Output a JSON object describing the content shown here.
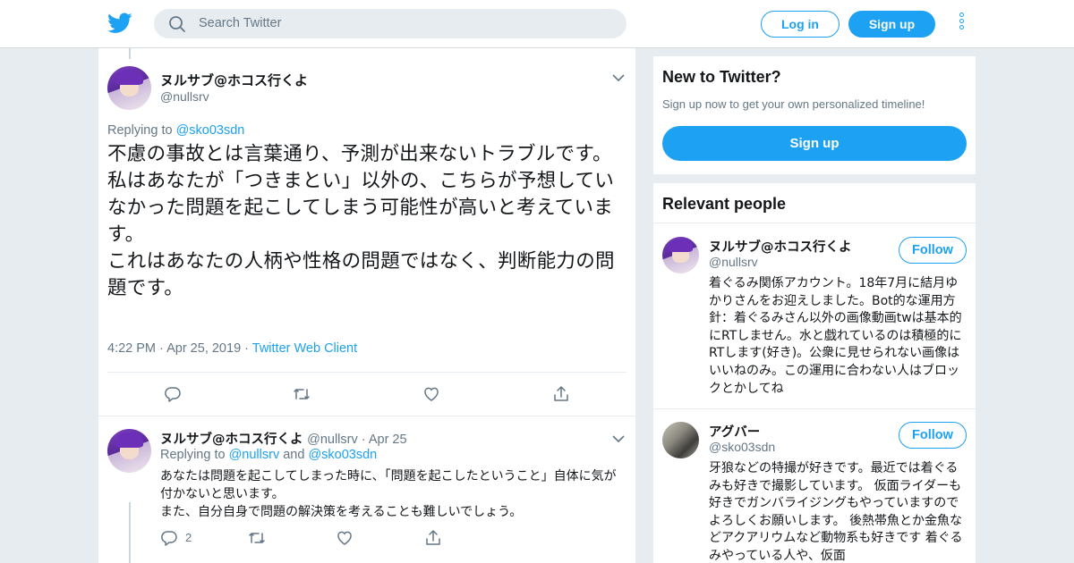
{
  "header": {
    "search_placeholder": "Search Twitter",
    "login_label": "Log in",
    "signup_label": "Sign up"
  },
  "tweet": {
    "author_name": "ヌルサブ@ホコス行くよ",
    "author_handle": "@nullsrv",
    "replying_to_prefix": "Replying to ",
    "replying_to": "@sko03sdn",
    "text": "不慮の事故とは言葉通り、予測が出来ないトラブルです。\n私はあなたが「つきまとい」以外の、こちらが予想していなかった問題を起こしてしまう可能性が高いと考えています。\nこれはあなたの人柄や性格の問題ではなく、判断能力の問題です。",
    "time": "4:22 PM",
    "date": "Apr 25, 2019",
    "source": "Twitter Web Client"
  },
  "reply": {
    "author_name": "ヌルサブ@ホコス行くよ",
    "author_handle": "@nullsrv",
    "date": "Apr 25",
    "replying_to_prefix": "Replying to ",
    "replying_to_1": "@nullsrv",
    "replying_to_and": " and ",
    "replying_to_2": "@sko03sdn",
    "text": "あなたは問題を起こしてしまった時に、「問題を起こしたということ」自体に気が付かないと思います。\nまた、自分自身で問題の解決策を考えることも難しいでしょう。",
    "reply_count": "2"
  },
  "sidebar": {
    "new_title": "New to Twitter?",
    "new_subtitle": "Sign up now to get your own personalized timeline!",
    "new_signup": "Sign up",
    "relevant_title": "Relevant people",
    "people": [
      {
        "name": "ヌルサブ@ホコス行くよ",
        "handle": "@nullsrv",
        "follow": "Follow",
        "bio": "着ぐるみ関係アカウント。18年7月に結月ゆかりさんをお迎えしました。Bot的な運用方針：着ぐるみさん以外の画像動画twは基本的にRTしません。水と戯れているのは積極的にRTします(好き)。公衆に見せられない画像はいいねのみ。この運用に合わない人はブロックとかしてね"
      },
      {
        "name": "アグバー",
        "handle": "@sko03sdn",
        "follow": "Follow",
        "bio": "牙狼などの特撮が好きです。最近では着ぐるみも好きで撮影しています。 仮面ライダーも好きでガンバライジングもやっていますのでよろしくお願いします。 後熱帯魚とか金魚などアクアリウムなど動物系も好きです 着ぐるみやっている人や、仮面"
      }
    ]
  },
  "colors": {
    "accent": "#1da1f2",
    "background": "#e6ecf0",
    "muted_text": "#657786"
  },
  "icons": {
    "logo": "twitter-bird-icon",
    "search": "search-icon",
    "more": "more-vertical-icon",
    "caret": "chevron-down-icon",
    "reply": "reply-icon",
    "retweet": "retweet-icon",
    "like": "heart-icon",
    "share": "share-icon"
  }
}
